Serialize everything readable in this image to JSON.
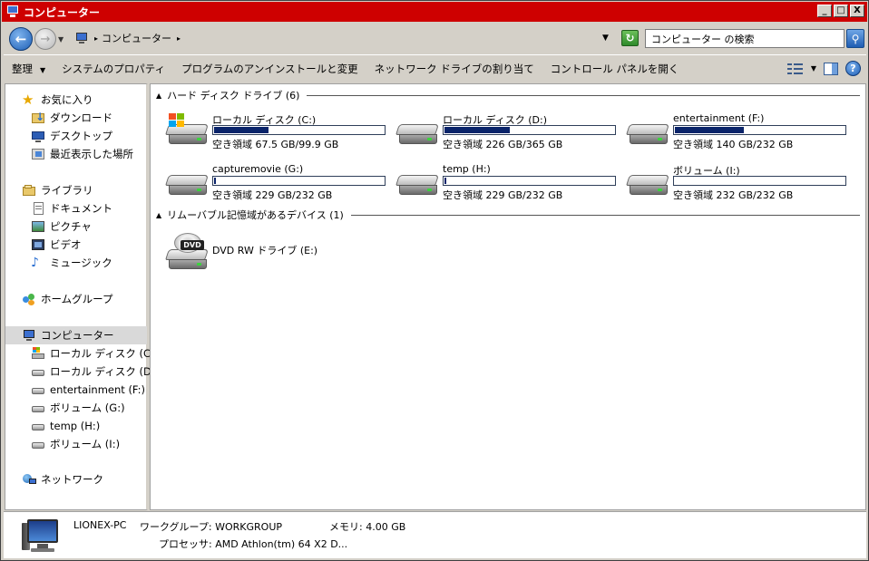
{
  "window": {
    "title": "コンピューター",
    "caption": {
      "minimize": "_",
      "maximize": "□",
      "close": "X"
    }
  },
  "address": {
    "back": "←",
    "forward": "→",
    "crumb": "コンピューター",
    "refresh": "↻",
    "search_placeholder": "コンピューター の検索"
  },
  "toolbar": {
    "organize": "整理",
    "system_properties": "システムのプロパティ",
    "uninstall": "プログラムのアンインストールと変更",
    "map_drive": "ネットワーク ドライブの割り当て",
    "control_panel": "コントロール パネルを開く",
    "help": "?"
  },
  "sidebar": {
    "favorites": {
      "label": "お気に入り",
      "items": [
        "ダウンロード",
        "デスクトップ",
        "最近表示した場所"
      ]
    },
    "libraries": {
      "label": "ライブラリ",
      "items": [
        "ドキュメント",
        "ピクチャ",
        "ビデオ",
        "ミュージック"
      ]
    },
    "homegroup": "ホームグループ",
    "computer": {
      "label": "コンピューター",
      "items": [
        "ローカル ディスク (C:)",
        "ローカル ディスク (D:)",
        "entertainment (F:)",
        "ボリューム (G:)",
        "temp (H:)",
        "ボリューム (I:)"
      ]
    },
    "network": "ネットワーク"
  },
  "content": {
    "hdd_group": "ハード ディスク ドライブ (6)",
    "removable_group": "リムーバブル記憶域があるデバイス (1)",
    "drives": [
      {
        "name": "ローカル ディスク (C:)",
        "free": "空き領域 67.5 GB/99.9 GB",
        "used_fraction": 0.32,
        "system": true
      },
      {
        "name": "ローカル ディスク (D:)",
        "free": "空き領域 226 GB/365 GB",
        "used_fraction": 0.38
      },
      {
        "name": "entertainment (F:)",
        "free": "空き領域 140 GB/232 GB",
        "used_fraction": 0.4
      },
      {
        "name": "capturemovie (G:)",
        "free": "空き領域 229 GB/232 GB",
        "used_fraction": 0.013
      },
      {
        "name": "temp (H:)",
        "free": "空き領域 229 GB/232 GB",
        "used_fraction": 0.013
      },
      {
        "name": "ボリューム (I:)",
        "free": "空き領域 232 GB/232 GB",
        "used_fraction": 0.0
      }
    ],
    "dvd": {
      "name": "DVD RW ドライブ (E:)",
      "label": "DVD"
    }
  },
  "details": {
    "pc_name": "LIONEX-PC",
    "workgroup": "ワークグループ: WORKGROUP",
    "memory": "メモリ: 4.00 GB",
    "processor": "プロセッサ: AMD Athlon(tm) 64 X2 D..."
  },
  "colors": {
    "titlebar": "#ce0000",
    "usage_bar": "#0a246a"
  }
}
